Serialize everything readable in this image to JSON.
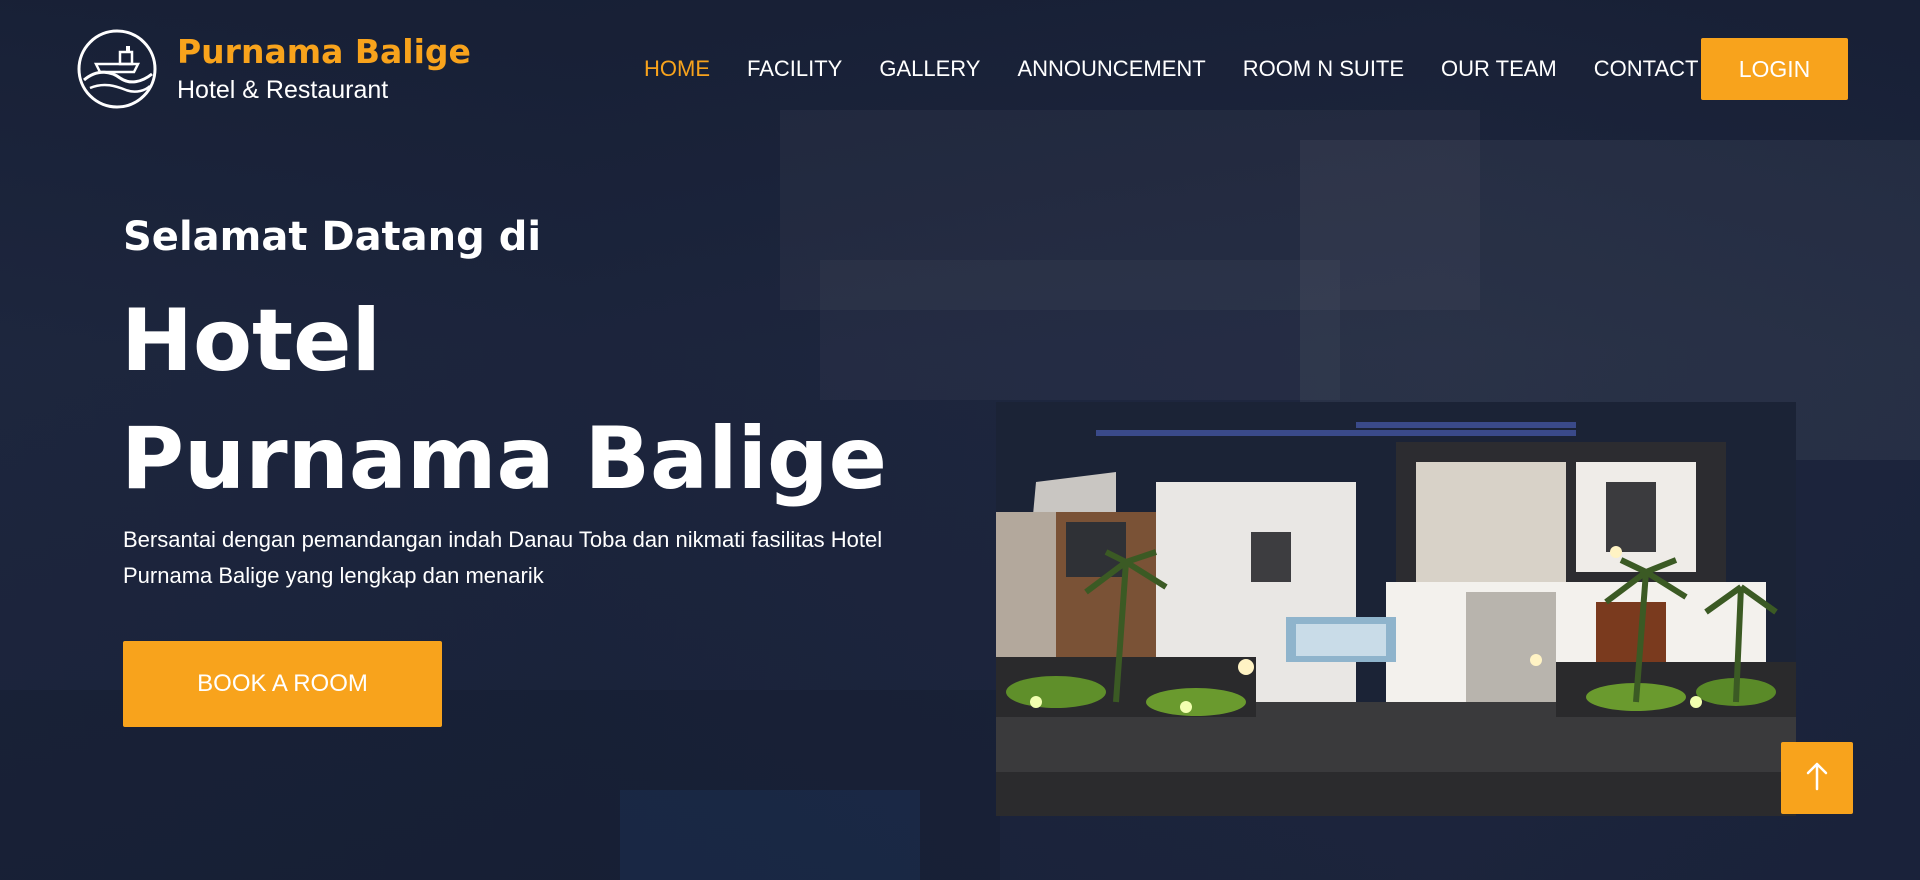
{
  "brand": {
    "name": "Purnama Balige",
    "subtitle": "Hotel & Restaurant",
    "logo_icon": "boat-wave-logo-icon"
  },
  "nav": {
    "items": [
      {
        "label": "HOME",
        "active": true
      },
      {
        "label": "FACILITY",
        "active": false
      },
      {
        "label": "GALLERY",
        "active": false
      },
      {
        "label": "ANNOUNCEMENT",
        "active": false
      },
      {
        "label": "ROOM N SUITE",
        "active": false
      },
      {
        "label": "OUR TEAM",
        "active": false
      },
      {
        "label": "CONTACT",
        "active": false
      }
    ],
    "login_label": "LOGIN"
  },
  "hero": {
    "welcome": "Selamat Datang di",
    "title_line1": "Hotel",
    "title_line2": "Purnama Balige",
    "description": "Bersantai dengan pemandangan indah Danau Toba dan nikmati fasilitas Hotel Purnama Balige yang lengkap dan menarik",
    "cta_label": "BOOK A ROOM"
  },
  "back_to_top": {
    "icon": "arrow-up-icon"
  },
  "colors": {
    "accent": "#f8a31c",
    "overlay": "#1a2238",
    "text": "#ffffff"
  }
}
